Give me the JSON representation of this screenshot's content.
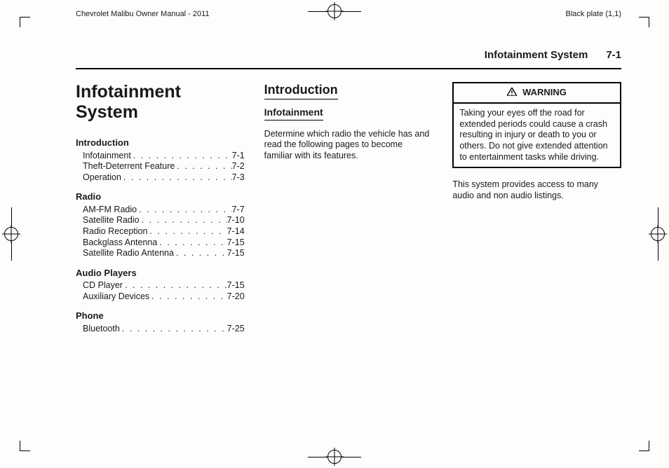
{
  "header": {
    "doc_title": "Chevrolet Malibu Owner Manual - 2011",
    "plate": "Black plate (1,1)"
  },
  "running_head": {
    "section": "Infotainment System",
    "page": "7-1"
  },
  "col1": {
    "title": "Infotainment System",
    "groups": [
      {
        "heading": "Introduction",
        "items": [
          {
            "label": "Infotainment",
            "page": "7-1"
          },
          {
            "label": "Theft-Deterrent Feature",
            "page": "7-2"
          },
          {
            "label": "Operation",
            "page": "7-3"
          }
        ]
      },
      {
        "heading": "Radio",
        "items": [
          {
            "label": "AM-FM Radio",
            "page": "7-7"
          },
          {
            "label": "Satellite Radio",
            "page": "7-10"
          },
          {
            "label": "Radio Reception",
            "page": "7-14"
          },
          {
            "label": "Backglass Antenna",
            "page": "7-15"
          },
          {
            "label": "Satellite Radio Antenna",
            "page": "7-15"
          }
        ]
      },
      {
        "heading": "Audio Players",
        "items": [
          {
            "label": "CD Player",
            "page": "7-15"
          },
          {
            "label": "Auxiliary Devices",
            "page": "7-20"
          }
        ]
      },
      {
        "heading": "Phone",
        "items": [
          {
            "label": "Bluetooth",
            "page": "7-25"
          }
        ]
      }
    ]
  },
  "col2": {
    "h2": "Introduction",
    "h3": "Infotainment",
    "para": "Determine which radio the vehicle has and read the following pages to become familiar with its features."
  },
  "col3": {
    "warning_label": "WARNING",
    "warning_body": "Taking your eyes off the road for extended periods could cause a crash resulting in injury or death to you or others. Do not give extended attention to entertainment tasks while driving.",
    "after": "This system provides access to many audio and non audio listings."
  }
}
